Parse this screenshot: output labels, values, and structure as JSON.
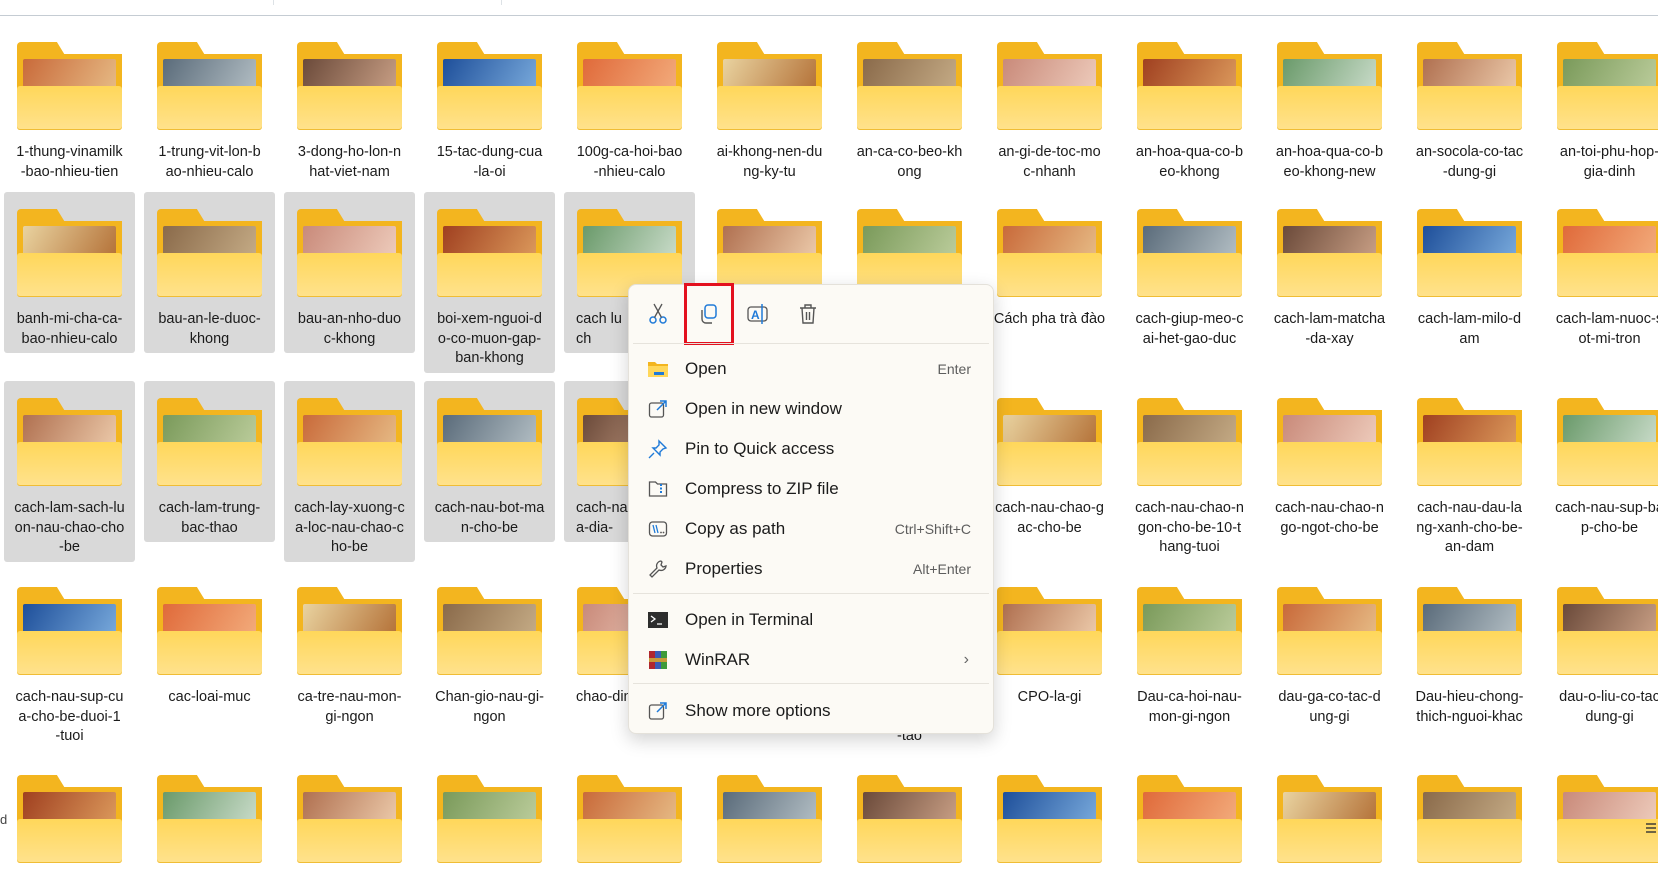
{
  "window": {
    "status_fragment": "d"
  },
  "accent_colors": {
    "folder_back": "#f3b51f",
    "folder_front": "#ffd75a",
    "selection": "#d9d9d9",
    "highlight_box": "#e3101e",
    "icon_blue": "#1f7ad8"
  },
  "rows": [
    {
      "items": [
        {
          "lines": [
            "1-thung-vinamilk",
            "-bao-nhieu-tien"
          ]
        },
        {
          "lines": [
            "1-trung-vit-lon-b",
            "ao-nhieu-calo"
          ]
        },
        {
          "lines": [
            "3-dong-ho-lon-n",
            "hat-viet-nam"
          ]
        },
        {
          "lines": [
            "15-tac-dung-cua",
            "-la-oi"
          ]
        },
        {
          "lines": [
            "100g-ca-hoi-bao",
            "-nhieu-calo"
          ]
        },
        {
          "lines": [
            "ai-khong-nen-du",
            "ng-ky-tu"
          ]
        },
        {
          "lines": [
            "an-ca-co-beo-kh",
            "ong"
          ]
        },
        {
          "lines": [
            "an-gi-de-toc-mo",
            "c-nhanh"
          ]
        },
        {
          "lines": [
            "an-hoa-qua-co-b",
            "eo-khong"
          ]
        },
        {
          "lines": [
            "an-hoa-qua-co-b",
            "eo-khong-new"
          ]
        },
        {
          "lines": [
            "an-socola-co-tac",
            "-dung-gi"
          ]
        },
        {
          "lines": [
            "an-toi-phu-hop-",
            "gia-dinh"
          ]
        }
      ]
    },
    {
      "items": [
        {
          "lines": [
            "banh-mi-cha-ca-",
            "bao-nhieu-calo"
          ],
          "selected": true
        },
        {
          "lines": [
            "bau-an-le-duoc-",
            "khong"
          ],
          "selected": true
        },
        {
          "lines": [
            "bau-an-nho-duo",
            "c-khong"
          ],
          "selected": true
        },
        {
          "lines": [
            "boi-xem-nguoi-d",
            "o-co-muon-gap-",
            "ban-khong"
          ],
          "selected": true
        },
        {
          "lines": [
            "cach lu",
            "ch"
          ],
          "selected": true,
          "clipped": true
        },
        {
          "lines": []
        },
        {
          "lines": []
        },
        {
          "lines": [
            "Cách pha trà đào"
          ]
        },
        {
          "lines": [
            "cach-giup-meo-c",
            "ai-het-gao-duc"
          ]
        },
        {
          "lines": [
            "cach-lam-matcha",
            "-da-xay"
          ]
        },
        {
          "lines": [
            "cach-lam-milo-d",
            "am"
          ]
        },
        {
          "lines": [
            "cach-lam-nuoc-s",
            "ot-mi-tron"
          ]
        }
      ]
    },
    {
      "items": [
        {
          "lines": [
            "cach-lam-sach-lu",
            "on-nau-chao-cho",
            "-be"
          ],
          "selected": true
        },
        {
          "lines": [
            "cach-lam-trung-",
            "bac-thao"
          ],
          "selected": true
        },
        {
          "lines": [
            "cach-lay-xuong-c",
            "a-loc-nau-chao-c",
            "ho-be"
          ],
          "selected": true
        },
        {
          "lines": [
            "cach-nau-bot-ma",
            "n-cho-be"
          ],
          "selected": true
        },
        {
          "lines": [
            "cach-nau",
            "a-dia-"
          ],
          "selected": true,
          "clipped": true
        },
        {
          "lines": []
        },
        {
          "lines": []
        },
        {
          "lines": [
            "cach-nau-chao-g",
            "ac-cho-be"
          ]
        },
        {
          "lines": [
            "cach-nau-chao-n",
            "gon-cho-be-10-t",
            "hang-tuoi"
          ]
        },
        {
          "lines": [
            "cach-nau-chao-n",
            "go-ngot-cho-be"
          ]
        },
        {
          "lines": [
            "cach-nau-dau-la",
            "ng-xanh-cho-be-",
            "an-dam"
          ]
        },
        {
          "lines": [
            "cach-nau-sup-ba",
            "p-cho-be"
          ]
        }
      ]
    },
    {
      "items": [
        {
          "lines": [
            "cach-nau-sup-cu",
            "a-cho-be-duoi-1",
            "-tuoi"
          ]
        },
        {
          "lines": [
            "cac-loai-muc"
          ]
        },
        {
          "lines": [
            "ca-tre-nau-mon-",
            "gi-ngon"
          ]
        },
        {
          "lines": [
            "Chan-gio-nau-gi-",
            "ngon"
          ]
        },
        {
          "lines": [
            "chao-din"
          ],
          "clipped": true
        },
        {
          "lines": []
        },
        {
          "lines": [
            "",
            "",
            "-tao"
          ]
        },
        {
          "lines": [
            "CPO-la-gi"
          ]
        },
        {
          "lines": [
            "Dau-ca-hoi-nau-",
            "mon-gi-ngon"
          ]
        },
        {
          "lines": [
            "dau-ga-co-tac-d",
            "ung-gi"
          ]
        },
        {
          "lines": [
            "Dau-hieu-chong-",
            "thich-nguoi-khac"
          ]
        },
        {
          "lines": [
            "dau-o-liu-co-tac",
            "dung-gi"
          ]
        }
      ]
    },
    {
      "items": [
        {
          "lines": []
        },
        {
          "lines": []
        },
        {
          "lines": []
        },
        {
          "lines": []
        },
        {
          "lines": []
        },
        {
          "lines": []
        },
        {
          "lines": []
        },
        {
          "lines": []
        },
        {
          "lines": []
        },
        {
          "lines": []
        },
        {
          "lines": []
        },
        {
          "lines": []
        }
      ]
    }
  ],
  "context_menu": {
    "toolbar": [
      {
        "name": "cut",
        "icon": "scissors-icon"
      },
      {
        "name": "copy",
        "icon": "copy-icon",
        "highlighted": true
      },
      {
        "name": "rename",
        "icon": "rename-icon"
      },
      {
        "name": "delete",
        "icon": "trash-icon"
      }
    ],
    "items": [
      {
        "label": "Open",
        "shortcut": "Enter",
        "icon": "folder-open-icon"
      },
      {
        "label": "Open in new window",
        "shortcut": "",
        "icon": "open-new-window-icon"
      },
      {
        "label": "Pin to Quick access",
        "shortcut": "",
        "icon": "pin-icon"
      },
      {
        "label": "Compress to ZIP file",
        "shortcut": "",
        "icon": "zip-icon"
      },
      {
        "label": "Copy as path",
        "shortcut": "Ctrl+Shift+C",
        "icon": "copy-path-icon"
      },
      {
        "label": "Properties",
        "shortcut": "Alt+Enter",
        "icon": "wrench-icon"
      },
      {
        "label": "Open in Terminal",
        "shortcut": "",
        "icon": "terminal-icon"
      },
      {
        "label": "WinRAR",
        "shortcut": "",
        "icon": "winrar-icon",
        "submenu": true
      },
      {
        "label": "Show more options",
        "shortcut": "",
        "icon": "show-more-icon"
      }
    ]
  }
}
